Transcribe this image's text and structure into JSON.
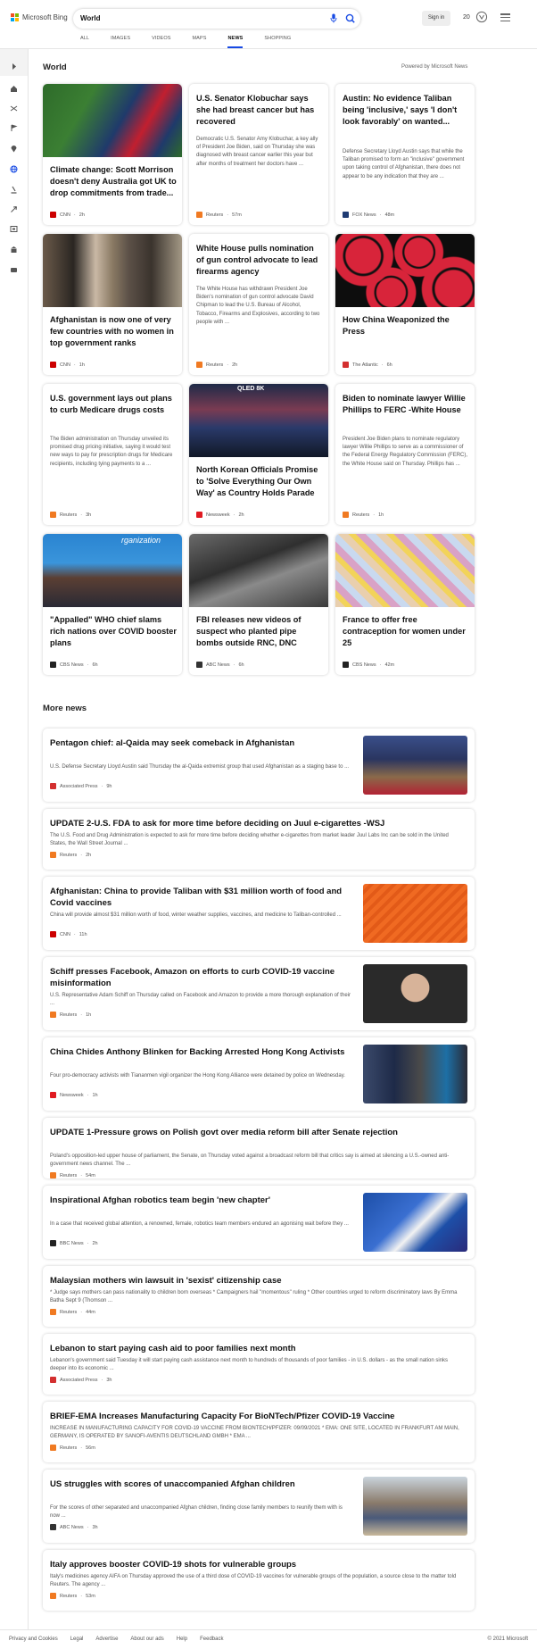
{
  "header": {
    "brand": "Microsoft Bing",
    "search_value": "World",
    "signin": "Sign in",
    "points": "20",
    "tabs": [
      "ALL",
      "IMAGES",
      "VIDEOS",
      "MAPS",
      "NEWS",
      "SHOPPING"
    ],
    "active_tab": "NEWS"
  },
  "colors": {
    "accent": "#174ae4",
    "logo": [
      "#f25022",
      "#7fba00",
      "#00a4ef",
      "#ffb900"
    ]
  },
  "sidebar": {
    "icons": [
      "expand-icon",
      "home-icon",
      "shuffle-icon",
      "flag-icon",
      "location-icon",
      "globe-icon",
      "microscope-icon",
      "rocket-icon",
      "film-icon",
      "building-icon",
      "video-icon"
    ]
  },
  "section": {
    "title": "World",
    "powered_by": "Powered by Microsoft News"
  },
  "cards": [
    {
      "title": "Climate change: Scott Morrison doesn't deny Australia got UK to drop commitments from trade...",
      "snippet": "",
      "source": "CNN",
      "time": "2h",
      "src_color": "#cc0000"
    },
    {
      "title": "U.S. Senator Klobuchar says she had breast cancer but has recovered",
      "snippet": "Democratic U.S. Senator Amy Klobuchar, a key ally of President Joe Biden, said on Thursday she was diagnosed with breast cancer earlier this year but after months of treatment her doctors have ...",
      "source": "Reuters",
      "time": "57m",
      "src_color": "#f07a22"
    },
    {
      "title": "Austin: No evidence Taliban being 'inclusive,' says 'I don't look favorably' on wanted...",
      "snippet": "Defense Secretary Lloyd Austin says that while the Taliban promised to form an \"inclusive\" government upon taking control of Afghanistan, there does not appear to be any indication that they are ...",
      "source": "FOX News",
      "time": "48m",
      "src_color": "#1f3b73"
    },
    {
      "title": "Afghanistan is now one of very few countries with no women in top government ranks",
      "snippet": "",
      "source": "CNN",
      "time": "1h",
      "src_color": "#cc0000"
    },
    {
      "title": "White House pulls nomination of gun control advocate to lead firearms agency",
      "snippet": "The White House has withdrawn President Joe Biden's nomination of gun control advocate David Chipman to lead the U.S. Bureau of Alcohol, Tobacco, Firearms and Explosives, according to two people with ...",
      "source": "Reuters",
      "time": "2h",
      "src_color": "#f07a22"
    },
    {
      "title": "How China Weaponized the Press",
      "snippet": "",
      "source": "The Atlantic",
      "time": "6h",
      "src_color": "#d32f2f"
    },
    {
      "title": "U.S. government lays out plans to curb Medicare drugs costs",
      "snippet": "The Biden administration on Thursday unveiled its promised drug pricing initiative, saying it would test new ways to pay for prescription drugs for Medicare recipients, including tying payments to a ...",
      "source": "Reuters",
      "time": "3h",
      "src_color": "#f07a22"
    },
    {
      "title": "North Korean Officials Promise to 'Solve Everything Our Own Way' as Country Holds Parade",
      "snippet": "",
      "source": "Newsweek",
      "time": "2h",
      "src_color": "#e01b22"
    },
    {
      "title": "Biden to nominate lawyer Willie Phillips to FERC -White House",
      "snippet": "President Joe Biden plans to nominate regulatory lawyer Willie Phillips to serve as a commissioner of the Federal Energy Regulatory Commission (FERC), the White House said on Thursday. Phillips has ...",
      "source": "Reuters",
      "time": "1h",
      "src_color": "#f07a22"
    },
    {
      "title": "\"Appalled\" WHO chief slams rich nations over COVID booster plans",
      "snippet": "",
      "source": "CBS News",
      "time": "6h",
      "src_color": "#222222"
    },
    {
      "title": "FBI releases new videos of suspect who planted pipe bombs outside RNC, DNC",
      "snippet": "",
      "source": "ABC News",
      "time": "6h",
      "src_color": "#333333"
    },
    {
      "title": "France to offer free contraception for women under 25",
      "snippet": "",
      "source": "CBS News",
      "time": "42m",
      "src_color": "#222222"
    }
  ],
  "card_image_text": {
    "qled": "QLED 8K",
    "who": "rganization"
  },
  "more_news": {
    "title": "More news",
    "items": [
      {
        "title": "Pentagon chief: al-Qaida may seek comeback in Afghanistan",
        "snippet": "U.S. Defense Secretary Lloyd Austin said Thursday the al-Qaida extremist group that used Afghanistan as a staging base to ...",
        "source": "Associated Press",
        "time": "9h",
        "src_color": "#d32f2f",
        "has_image": true
      },
      {
        "title": "UPDATE 2-U.S. FDA to ask for more time before deciding on Juul e-cigarettes -WSJ",
        "snippet": "The U.S. Food and Drug Administration is expected to ask for more time before deciding whether e-cigarettes from market leader Juul Labs Inc can be sold in the United States, the Wall Street Journal ...",
        "source": "Reuters",
        "time": "2h",
        "src_color": "#f07a22",
        "has_image": false
      },
      {
        "title": "Afghanistan: China to provide Taliban with $31 million worth of food and Covid vaccines",
        "snippet": "China will provide almost $31 million worth of food, winter weather supplies, vaccines, and medicine to Taliban-controlled ...",
        "source": "CNN",
        "time": "11h",
        "src_color": "#cc0000",
        "has_image": true
      },
      {
        "title": "Schiff presses Facebook, Amazon on efforts to curb COVID-19 vaccine misinformation",
        "snippet": "U.S. Representative Adam Schiff on Thursday called on Facebook and Amazon to provide a more thorough explanation of their ...",
        "source": "Reuters",
        "time": "1h",
        "src_color": "#f07a22",
        "has_image": true
      },
      {
        "title": "China Chides Anthony Blinken for Backing Arrested Hong Kong Activists",
        "snippet": "Four pro-democracy activists with Tiananmen vigil organizer the Hong Kong Alliance were detained by police on Wednesday.",
        "source": "Newsweek",
        "time": "1h",
        "src_color": "#e01b22",
        "has_image": true
      },
      {
        "title": "UPDATE 1-Pressure grows on Polish govt over media reform bill after Senate rejection",
        "snippet": "Poland's opposition-led upper house of parliament, the Senate, on Thursday voted against a broadcast reform bill that critics say is aimed at silencing a U.S.-owned anti-government news channel. The ...",
        "source": "Reuters",
        "time": "54m",
        "src_color": "#f07a22",
        "has_image": false
      },
      {
        "title": "Inspirational Afghan robotics team begin 'new chapter'",
        "snippet": "In a case that received global attention, a renowned, female, robotics team members endured an agonising wait before they ...",
        "source": "BBC News",
        "time": "2h",
        "src_color": "#222222",
        "has_image": true
      },
      {
        "title": "Malaysian mothers win lawsuit in 'sexist' citizenship case",
        "snippet": "* Judge says mothers can pass nationality to children born overseas * Campaigners hail \"momentous\" ruling * Other countries urged to reform discriminatory laws By Emma Batha Sept 9 (Thomson ...",
        "source": "Reuters",
        "time": "44m",
        "src_color": "#f07a22",
        "has_image": false
      },
      {
        "title": "Lebanon to start paying cash aid to poor families next month",
        "snippet": "Lebanon's government said Tuesday it will start paying cash assistance next month to hundreds of thousands of poor families - in U.S. dollars - as the small nation sinks deeper into its economic ...",
        "source": "Associated Press",
        "time": "3h",
        "src_color": "#d32f2f",
        "has_image": false
      },
      {
        "title": "BRIEF-EMA Increases Manufacturing Capacity For BioNTech/Pfizer COVID-19 Vaccine",
        "snippet": "INCREASE IN MANUFACTURING CAPACITY FOR COVID-19 VACCINE FROM BIONTECH/PFIZER: 09/09/2021 * EMA: ONE SITE, LOCATED IN FRANKFURT AM MAIN, GERMANY, IS OPERATED BY SANOFI-AVENTIS DEUTSCHLAND GMBH * EMA ...",
        "source": "Reuters",
        "time": "56m",
        "src_color": "#f07a22",
        "has_image": false
      },
      {
        "title": "US struggles with scores of unaccompanied Afghan children",
        "snippet": "For the scores of other separated and unaccompanied Afghan children, finding close family members to reunify them with is now ...",
        "source": "ABC News",
        "time": "3h",
        "src_color": "#333333",
        "has_image": true
      },
      {
        "title": "Italy approves booster COVID-19 shots for vulnerable groups",
        "snippet": "Italy's medicines agency AIFA on Thursday approved the use of a third dose of COVID-19 vaccines for vulnerable groups of the population, a source close to the matter told Reuters. The agency ...",
        "source": "Reuters",
        "time": "53m",
        "src_color": "#f07a22",
        "has_image": false
      }
    ]
  },
  "footer": {
    "links": [
      "Privacy and Cookies",
      "Legal",
      "Advertise",
      "About our ads",
      "Help",
      "Feedback"
    ],
    "copyright": "© 2021 Microsoft"
  }
}
